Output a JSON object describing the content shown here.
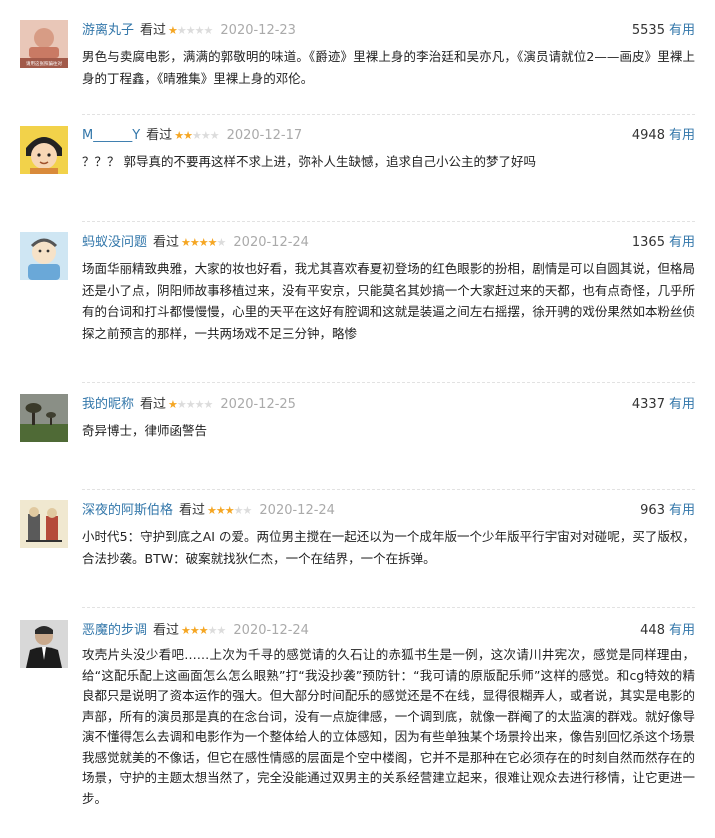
{
  "reviews": [
    {
      "author": "游离丸子",
      "status": "看过",
      "rating": 1,
      "date": "2020-12-23",
      "votes": "5535",
      "useful_label": "有用",
      "avatar_caption": "请用这张照骗往对",
      "text": "男色与卖腐电影，满满的郭敬明的味道。《爵迹》里裸上身的李治廷和吴亦凡，《演员请就位2——画皮》里裸上身的丁程鑫，《晴雅集》里裸上身的邓伦。"
    },
    {
      "author": "M______Y",
      "status": "看过",
      "rating": 2,
      "date": "2020-12-17",
      "votes": "4948",
      "useful_label": "有用",
      "text": "？？？ 郭导真的不要再这样不求上进，弥补人生缺憾，追求自己小公主的梦了好吗"
    },
    {
      "author": "蚂蚁没问题",
      "status": "看过",
      "rating": 4,
      "date": "2020-12-24",
      "votes": "1365",
      "useful_label": "有用",
      "text": "场面华丽精致典雅，大家的妆也好看，我尤其喜欢春夏初登场的红色眼影的扮相，剧情是可以自圆其说，但格局还是小了点，阴阳师故事移植过来，没有平安京，只能莫名其妙搞一个大家赶过来的天都，也有点奇怪，几乎所有的台词和打斗都慢慢慢，心里的天平在这好有腔调和这就是装逼之间左右摇摆，徐开骋的戏份果然如本粉丝侦探之前预言的那样，一共两场戏不足三分钟，略惨"
    },
    {
      "author": "我的昵称",
      "status": "看过",
      "rating": 1,
      "date": "2020-12-25",
      "votes": "4337",
      "useful_label": "有用",
      "text": "奇异博士，律师函警告"
    },
    {
      "author": "深夜的阿斯伯格",
      "status": "看过",
      "rating": 3,
      "date": "2020-12-24",
      "votes": "963",
      "useful_label": "有用",
      "text": "小时代5：守护到底之AI の爱。两位男主搅在一起还以为一个成年版一个少年版平行宇宙对对碰呢，买了版权，合法抄袭。BTW：破案就找狄仁杰，一个在结界，一个在拆弹。"
    },
    {
      "author": "恶魔的步调",
      "status": "看过",
      "rating": 3,
      "date": "2020-12-24",
      "votes": "448",
      "useful_label": "有用",
      "text": "攻壳片头没少看吧……上次为千寻的感觉请的久石让的赤狐书生是一例，这次请川井宪次，感觉是同样理由，给“这配乐配上这画面怎么怎么眼熟”打“我没抄袭”预防针：“我可请的原版配乐师”这样的感觉。和cg特效的精良都只是说明了资本运作的强大。但大部分时间配乐的感觉还是不在线，显得很糊弄人，或者说，其实是电影的声部，所有的演员那是真的在念台词，没有一点旋律感，一个调到底，就像一群阉了的太监演的群戏。就好像导演不懂得怎么去调和电影作为一个整体给人的立体感知，因为有些单独某个场景拎出来，像告别回忆杀这个场景我感觉就美的不像话，但它在感性情感的层面是个空中楼阁，它并不是那种在它必须存在的时刻自然而然存在的场景，守护的主题太想当然了，完全没能通过双男主的关系经营建立起来，很难让观众去进行移情，让它更进一步。"
    }
  ],
  "colors": {
    "link": "#3377aa",
    "star_on": "#f5a623",
    "star_off": "#dcdcdc",
    "date": "#aaaaaa"
  }
}
